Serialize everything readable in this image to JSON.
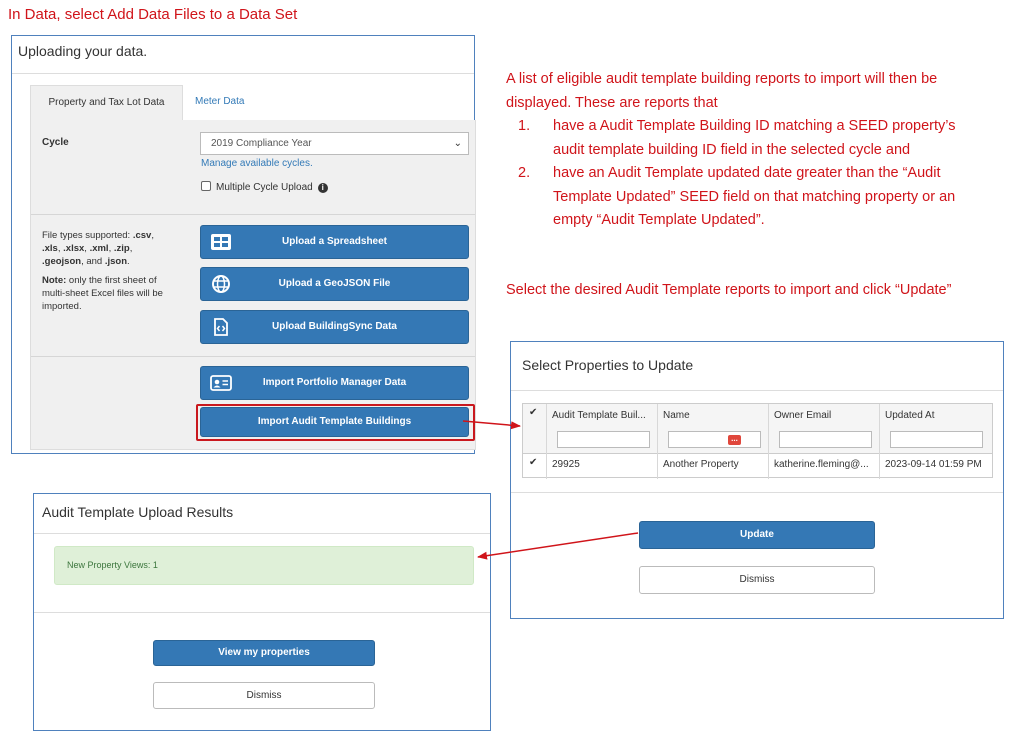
{
  "captions": {
    "top": "In Data, select Add Data Files to a Data Set",
    "intro": "A list of eligible audit template building reports to import will then be displayed. These are reports that",
    "items": [
      {
        "num": "1.",
        "text": "have a Audit Template Building ID matching a SEED property’s audit template building ID field in the selected cycle and"
      },
      {
        "num": "2.",
        "text": "have an Audit Template updated date greater than the “Audit Template Updated” SEED field on that matching property or an empty “Audit Template Updated”."
      }
    ],
    "select": "Select the desired Audit Template reports to import and click “Update”"
  },
  "upload": {
    "title": "Uploading your data.",
    "tabs": [
      "Property and Tax Lot Data",
      "Meter Data"
    ],
    "cycle_label": "Cycle",
    "cycle_value": "2019 Compliance Year",
    "manage_link": "Manage available cycles.",
    "multi_cycle": "Multiple Cycle Upload",
    "filetypes_prefix": "File types supported: ",
    "filetypes": [
      ".csv",
      ".xls",
      ".xlsx",
      ".xml",
      ".zip",
      ".geojson",
      ".json"
    ],
    "note_label": "Note:",
    "note_text": " only the first sheet of multi-sheet Excel files will be imported.",
    "buttons": {
      "spreadsheet": "Upload a Spreadsheet",
      "geojson": "Upload a GeoJSON File",
      "buildingsync": "Upload BuildingSync Data",
      "portfolio": "Import Portfolio Manager Data",
      "audit_template": "Import Audit Template Buildings"
    }
  },
  "select_dialog": {
    "title": "Select Properties to Update",
    "columns": [
      "Audit Template Buil...",
      "Name",
      "Owner Email",
      "Updated At"
    ],
    "rows": [
      {
        "checked": true,
        "id": "29925",
        "name": "Another Property",
        "email": "katherine.fleming@...",
        "updated": "2023-09-14 01:59 PM"
      }
    ],
    "update_label": "Update",
    "dismiss_label": "Dismiss"
  },
  "results_dialog": {
    "title": "Audit Template Upload Results",
    "message": "New Property Views: 1",
    "view_label": "View my properties",
    "dismiss_label": "Dismiss"
  },
  "colors": {
    "annotation": "#d0141a",
    "primary_button": "#3478b5",
    "panel_border": "#4f81bd",
    "success_bg": "#dff0d8"
  }
}
